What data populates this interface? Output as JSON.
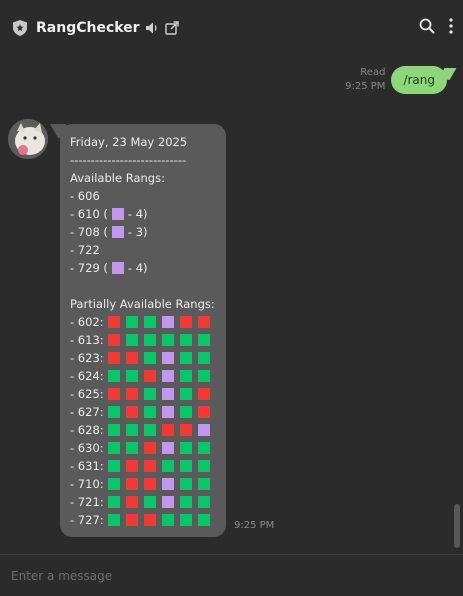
{
  "header": {
    "title": "RangChecker"
  },
  "outgoing": {
    "text": "/rang",
    "status": "Read",
    "time": "9:25 PM"
  },
  "incoming": {
    "date": "Friday, 23 May 2025",
    "separator": "----------------------------",
    "available_heading": "Available Rangs:",
    "available": [
      {
        "pre": "- 606"
      },
      {
        "pre": "- 610 (",
        "post": " - 4)"
      },
      {
        "pre": "- 708 (",
        "post": " - 3)"
      },
      {
        "pre": "- 722"
      },
      {
        "pre": "- 729 (",
        "post": " - 4)"
      }
    ],
    "partial_heading": "Partially Available Rangs:",
    "partial": [
      {
        "label": "- 602:",
        "slots": [
          "red",
          "green",
          "green",
          "purple",
          "red",
          "red"
        ]
      },
      {
        "label": "- 613:",
        "slots": [
          "red",
          "green",
          "green",
          "green",
          "green",
          "green"
        ]
      },
      {
        "label": "- 623:",
        "slots": [
          "red",
          "red",
          "green",
          "purple",
          "green",
          "green"
        ]
      },
      {
        "label": "- 624:",
        "slots": [
          "green",
          "green",
          "red",
          "purple",
          "green",
          "green"
        ]
      },
      {
        "label": "- 625:",
        "slots": [
          "red",
          "red",
          "green",
          "purple",
          "green",
          "red"
        ]
      },
      {
        "label": "- 627:",
        "slots": [
          "green",
          "red",
          "green",
          "purple",
          "green",
          "red"
        ]
      },
      {
        "label": "- 628:",
        "slots": [
          "green",
          "green",
          "green",
          "red",
          "red",
          "purple"
        ]
      },
      {
        "label": "- 630:",
        "slots": [
          "green",
          "green",
          "red",
          "purple",
          "green",
          "green"
        ]
      },
      {
        "label": "- 631:",
        "slots": [
          "green",
          "red",
          "red",
          "green",
          "green",
          "green"
        ]
      },
      {
        "label": "- 710:",
        "slots": [
          "green",
          "red",
          "red",
          "purple",
          "green",
          "green"
        ]
      },
      {
        "label": "- 721:",
        "slots": [
          "green",
          "red",
          "green",
          "purple",
          "green",
          "green"
        ]
      },
      {
        "label": "- 727:",
        "slots": [
          "green",
          "red",
          "red",
          "green",
          "green",
          "green"
        ]
      }
    ],
    "time": "9:25 PM"
  },
  "composer": {
    "placeholder": "Enter a message"
  },
  "colors": {
    "background": "#2b2b2b",
    "outgoing_bubble": "#8fd57a",
    "incoming_bubble": "#5a5a5a",
    "slot_green": "#0ac569",
    "slot_red": "#f03a35",
    "slot_purple": "#c497ee"
  },
  "icons": [
    "shield-icon",
    "speaker-icon",
    "open-window-icon",
    "search-icon",
    "more-vert-icon"
  ]
}
